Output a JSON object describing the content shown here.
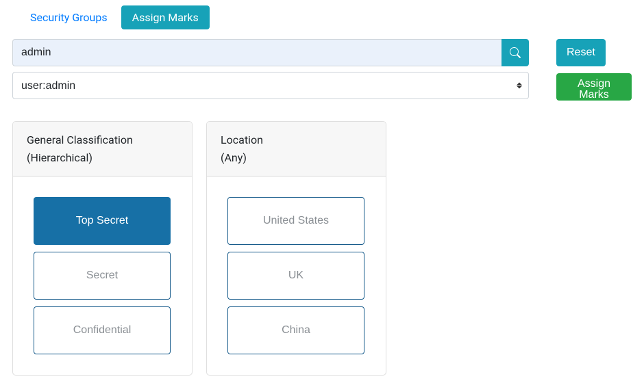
{
  "tabs": {
    "security_groups": "Security Groups",
    "assign_marks": "Assign Marks"
  },
  "search": {
    "value": "admin"
  },
  "user_select": {
    "selected": "user:admin"
  },
  "buttons": {
    "reset": "Reset",
    "assign_marks": "Assign Marks"
  },
  "cards": [
    {
      "title_line1": "General Classification",
      "title_line2": "(Hierarchical)",
      "marks": [
        {
          "label": "Top Secret",
          "selected": true
        },
        {
          "label": "Secret",
          "selected": false
        },
        {
          "label": "Confidential",
          "selected": false
        }
      ]
    },
    {
      "title_line1": "Location",
      "title_line2": "(Any)",
      "marks": [
        {
          "label": "United States",
          "selected": false
        },
        {
          "label": "UK",
          "selected": false
        },
        {
          "label": "China",
          "selected": false
        }
      ]
    }
  ]
}
